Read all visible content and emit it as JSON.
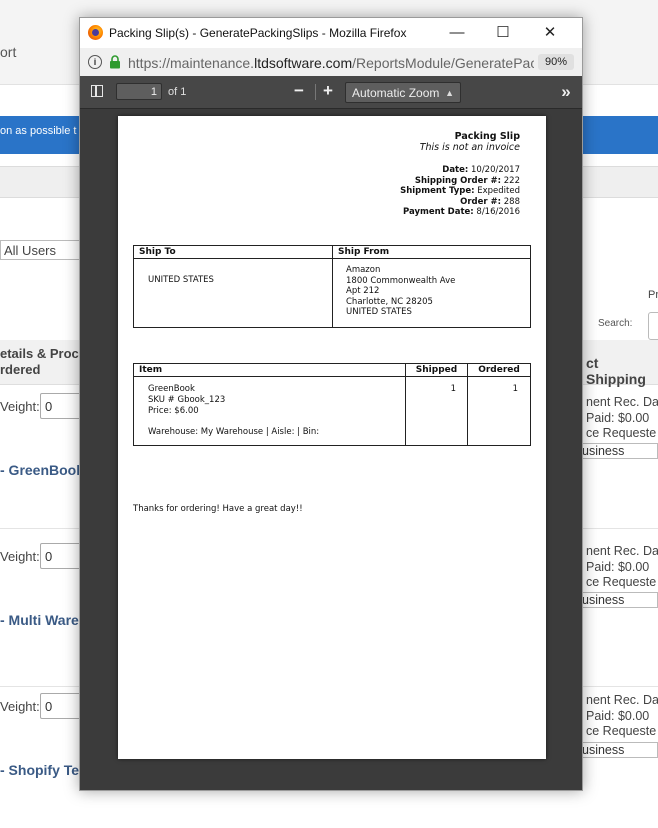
{
  "background": {
    "title_fragment": "ort",
    "banner_text": "on as possible t",
    "users_select": "All Users",
    "pr_fragment": "Pr",
    "search_label": "Search:",
    "col_details": [
      "etails & Proc",
      "rdered"
    ],
    "col_shipping": "ct Shipping",
    "rows": [
      {
        "weight_label": "Veight:",
        "weight_value": "0",
        "product": "- GreenBook",
        "right_lines": [
          "nent Rec. Da",
          "Paid: $0.00",
          "ce Requeste"
        ],
        "service": "usiness"
      },
      {
        "weight_label": "Veight:",
        "weight_value": "0",
        "product": "- Multi Ware",
        "right_lines": [
          "nent Rec. Da",
          "Paid: $0.00",
          "ce Requeste"
        ],
        "service": "usiness"
      },
      {
        "weight_label": "Veight:",
        "weight_value": "0",
        "product": "- Shopify Te",
        "right_lines": [
          "nent Rec. Da",
          "Paid: $0.00",
          "ce Requeste"
        ],
        "service": "usiness"
      }
    ]
  },
  "window": {
    "title": "Packing Slip(s) - GeneratePackingSlips - Mozilla Firefox",
    "url_prefix": "https://maintenance.",
    "url_host": "ltdsoftware.com",
    "url_path": "/ReportsModule/GeneratePac",
    "zoom_badge": "90%"
  },
  "pdf_toolbar": {
    "page_number": "1",
    "page_of": "of 1",
    "zoom_out": "−",
    "zoom_in": "+",
    "zoom_mode": "Automatic Zoom",
    "more": "»"
  },
  "slip": {
    "title": "Packing Slip",
    "subtitle": "This is not an invoice",
    "date_label": "Date:",
    "date": "10/20/2017",
    "shipping_order_label": "Shipping Order #:",
    "shipping_order": "222",
    "shipment_type_label": "Shipment Type:",
    "shipment_type": "Expedited",
    "order_label": "Order #:",
    "order": "288",
    "payment_date_label": "Payment Date:",
    "payment_date": "8/16/2016",
    "ship_to_header": "Ship To",
    "ship_from_header": "Ship From",
    "ship_to": [
      "UNITED STATES"
    ],
    "ship_from": [
      "Amazon",
      "1800 Commonwealth Ave",
      "Apt 212",
      "Charlotte, NC 28205",
      "UNITED STATES"
    ],
    "item_header": "Item",
    "shipped_header": "Shipped",
    "ordered_header": "Ordered",
    "item_lines": [
      "GreenBook",
      "SKU # Gbook_123",
      "Price: $6.00"
    ],
    "shipped": "1",
    "ordered": "1",
    "warehouse_line": "Warehouse: My Warehouse | Aisle: | Bin:",
    "thanks": "Thanks for ordering! Have a great day!!"
  }
}
